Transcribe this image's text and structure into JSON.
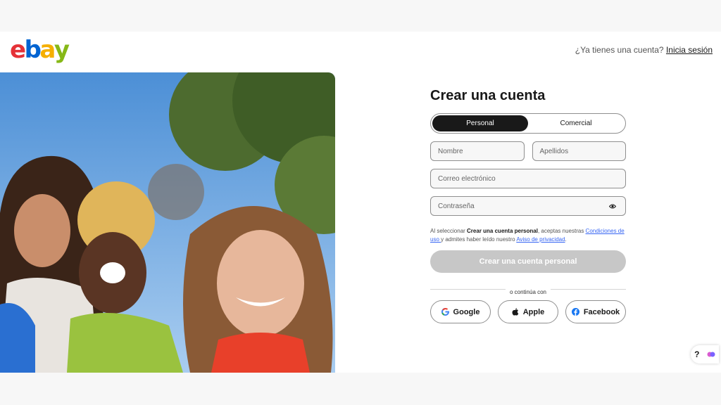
{
  "header": {
    "logo_letters": [
      "e",
      "b",
      "a",
      "y"
    ],
    "logo_colors": [
      "#e53238",
      "#0064d2",
      "#f5af02",
      "#86b817"
    ],
    "signin_prompt": "¿Ya tienes una cuenta?",
    "signin_link": "Inicia sesión"
  },
  "form": {
    "title": "Crear una cuenta",
    "tabs": [
      "Personal",
      "Comercial"
    ],
    "active_tab": "Personal",
    "first_name_placeholder": "Nombre",
    "last_name_placeholder": "Apellidos",
    "email_placeholder": "Correo electrónico",
    "password_placeholder": "Contraseña",
    "legal": {
      "part1": "Al seleccionar ",
      "bold": "Crear una cuenta personal",
      "part2": ", aceptas nuestras ",
      "terms_link": "Condiciones de uso ",
      "part3": "y admites haber leído nuestro ",
      "privacy_link": "Aviso de privacidad",
      "part4": "."
    },
    "submit_label": "Crear una cuenta personal",
    "divider_text": "o continúa con",
    "social": [
      "Google",
      "Apple",
      "Facebook"
    ]
  },
  "help": {
    "label": "?"
  },
  "colors": {
    "accent_link": "#3665f3",
    "button_disabled": "#c7c7c7",
    "tab_active": "#191919"
  }
}
